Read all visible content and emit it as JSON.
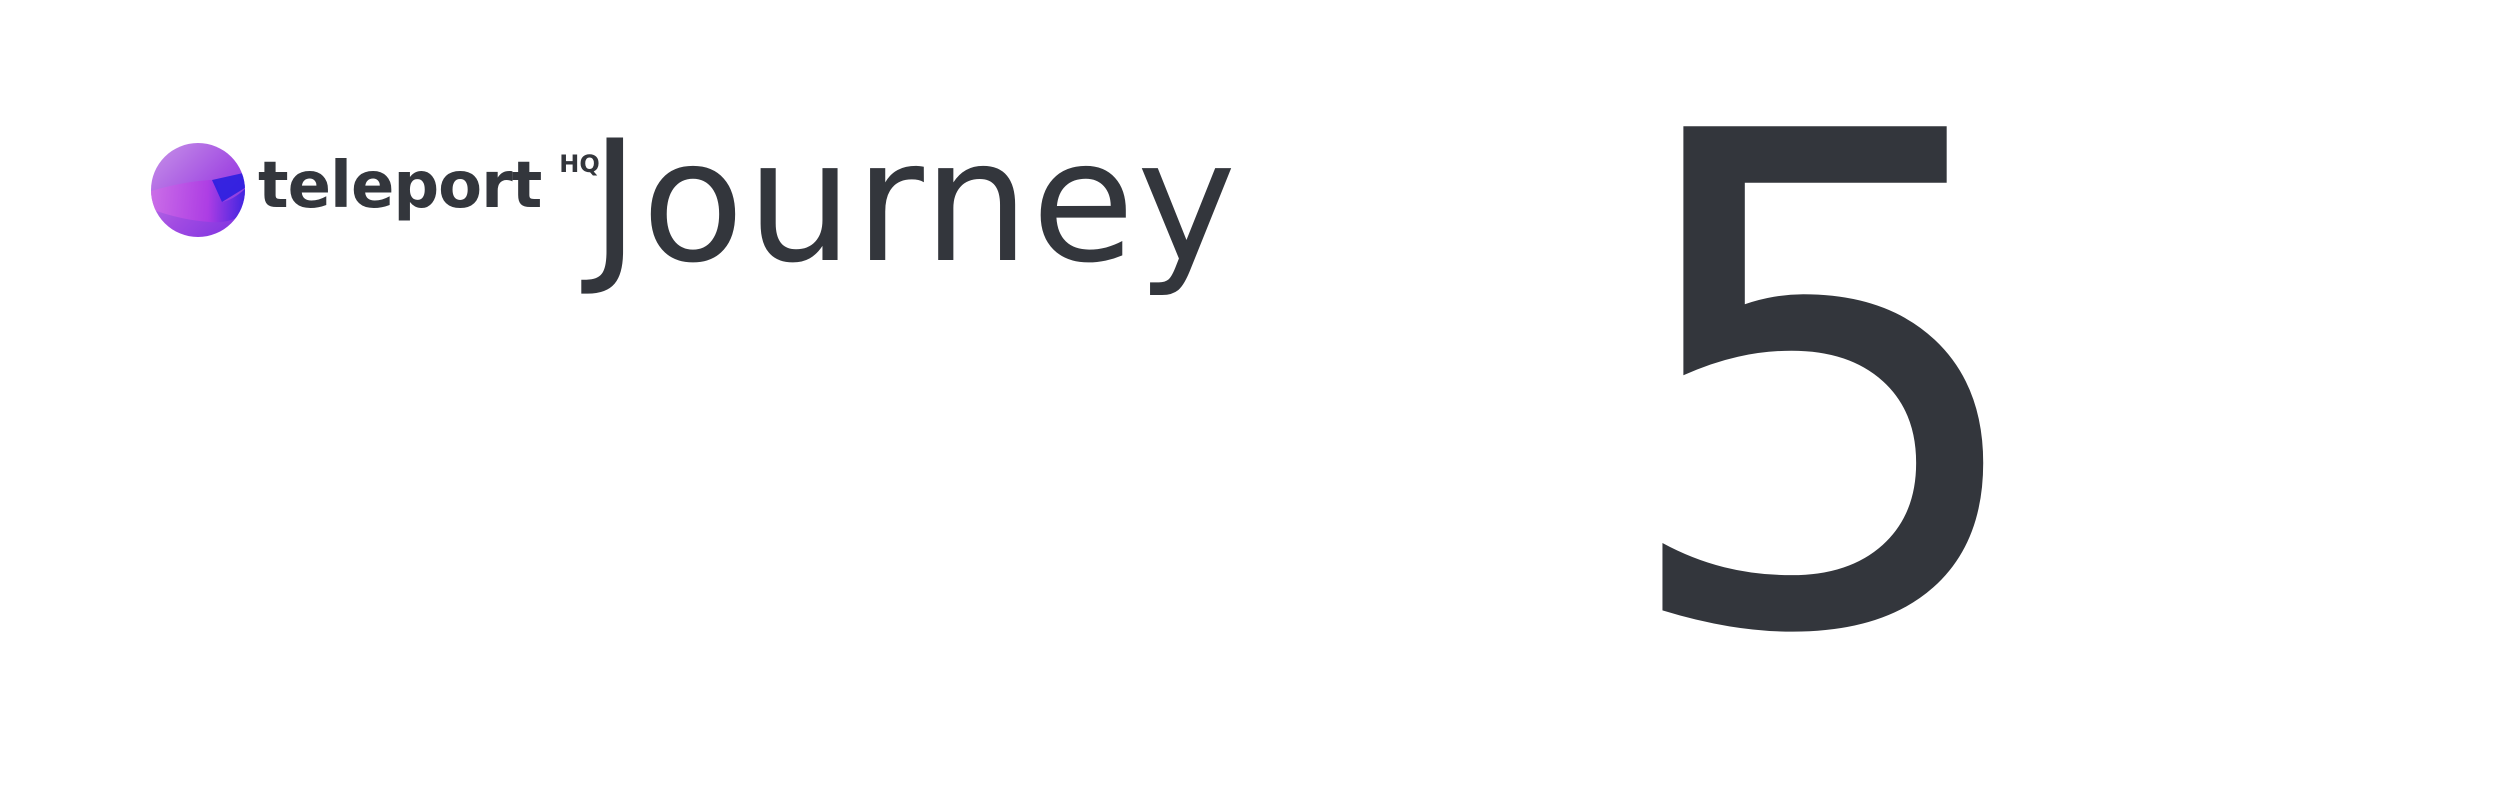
{
  "logo": {
    "icon": "teleport-orb-icon",
    "wordmark": "teleport",
    "suffix": "HQ"
  },
  "title": "Journey",
  "number": "5",
  "colors": {
    "text": "#33363c",
    "background": "#ffffff",
    "orb_light": "#c07ae6",
    "orb_mid": "#9b3fe0",
    "orb_deep": "#2a1fe0"
  }
}
